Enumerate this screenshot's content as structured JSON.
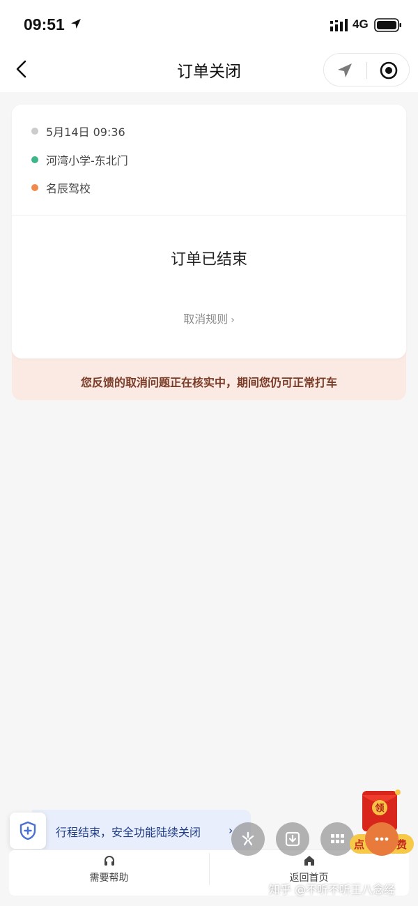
{
  "status_bar": {
    "time": "09:51",
    "network": "4G"
  },
  "nav": {
    "title": "订单关闭"
  },
  "trip": {
    "time": "5月14日 09:36",
    "start": "河湾小学-东北门",
    "end": "名辰驾校",
    "colors": {
      "time_dot": "#cccccc",
      "start_dot": "#3fb58a",
      "end_dot": "#ef8a4c"
    }
  },
  "order": {
    "status": "订单已结束",
    "cancel_rules": "取消规则",
    "cancel_rules_chevron": "›"
  },
  "notice": {
    "text": "您反馈的取消问题正在核实中，期间您仍可正常打车"
  },
  "safety": {
    "text": "行程结束，安全功能陆续关闭",
    "chevron": "›"
  },
  "bottom": {
    "help": "需要帮助",
    "home": "返回首页"
  },
  "promo": {
    "packet_char": "领",
    "left": "点",
    "right": "费"
  },
  "watermark": "知乎 @不听不听王八念经",
  "icons": {
    "back": "chevron-left-icon",
    "location": "navigation-arrow-icon",
    "record": "record-circle-icon",
    "shield": "shield-plus-icon",
    "headset": "headset-icon",
    "home": "home-icon"
  }
}
